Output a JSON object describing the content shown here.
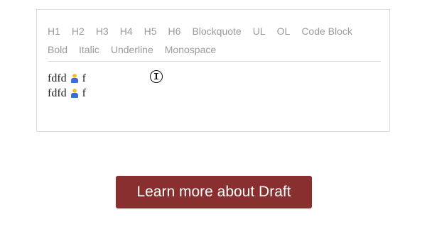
{
  "toolbar": {
    "row1": [
      "H1",
      "H2",
      "H3",
      "H4",
      "H5",
      "H6",
      "Blockquote",
      "UL",
      "OL",
      "Code Block"
    ],
    "row2": [
      "Bold",
      "Italic",
      "Underline",
      "Monospace"
    ]
  },
  "content": {
    "lines": [
      {
        "before": "fdfd",
        "icon": "person-emoji-icon",
        "after": "f"
      },
      {
        "before": "fdfd",
        "icon": "person-emoji-icon",
        "after": "f"
      }
    ]
  },
  "cta": {
    "label": "Learn more about Draft"
  },
  "colors": {
    "toolbar_text": "#9a9a9a",
    "border": "#dddddd",
    "button_bg": "#8a2f2f",
    "button_text": "#ffffff"
  }
}
